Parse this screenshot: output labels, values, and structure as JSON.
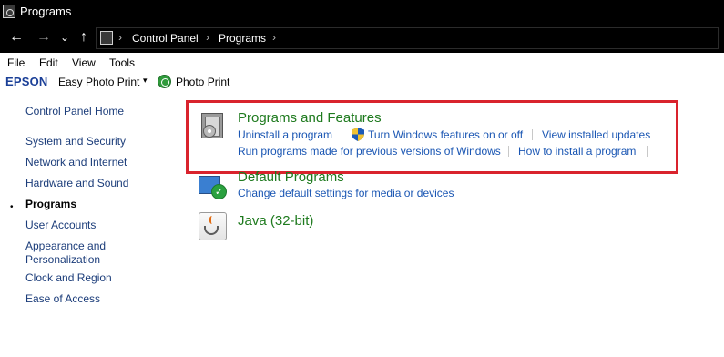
{
  "window": {
    "title": "Programs"
  },
  "nav": {
    "back_glyph": "←",
    "forward_glyph": "→",
    "recent_glyph": "⌄",
    "up_glyph": "↑",
    "breadcrumb": [
      "Control Panel",
      "Programs"
    ],
    "separator": "›"
  },
  "menu": [
    "File",
    "Edit",
    "View",
    "Tools"
  ],
  "epson_toolbar": {
    "brand": "EPSON",
    "easy_photo_print": "Easy Photo Print",
    "caret": "▾",
    "photo_print": "Photo Print"
  },
  "sidebar": {
    "items": [
      {
        "label": "Control Panel Home"
      },
      {
        "label": "System and Security"
      },
      {
        "label": "Network and Internet"
      },
      {
        "label": "Hardware and Sound"
      },
      {
        "label": "Programs"
      },
      {
        "label": "User Accounts"
      },
      {
        "label": "Appearance and Personalization"
      },
      {
        "label": "Clock and Region"
      },
      {
        "label": "Ease of Access"
      }
    ],
    "current_bullet": "•"
  },
  "categories": {
    "programs_features": {
      "title": "Programs and Features",
      "links": [
        "Uninstall a program",
        "Turn Windows features on or off",
        "View installed updates",
        "Run programs made for previous versions of Windows",
        "How to install a program"
      ],
      "icon": "programs-features-icon"
    },
    "default_programs": {
      "title": "Default Programs",
      "links": [
        "Change default settings for media or devices"
      ],
      "icon": "default-programs-icon"
    },
    "java": {
      "title": "Java (32-bit)",
      "icon": "java-icon"
    }
  },
  "colors": {
    "title_bar": "#000000",
    "link": "#1a56b3",
    "category_title": "#1e7a1e",
    "highlight_border": "#d9232d",
    "epson_brand": "#1a3f97"
  }
}
